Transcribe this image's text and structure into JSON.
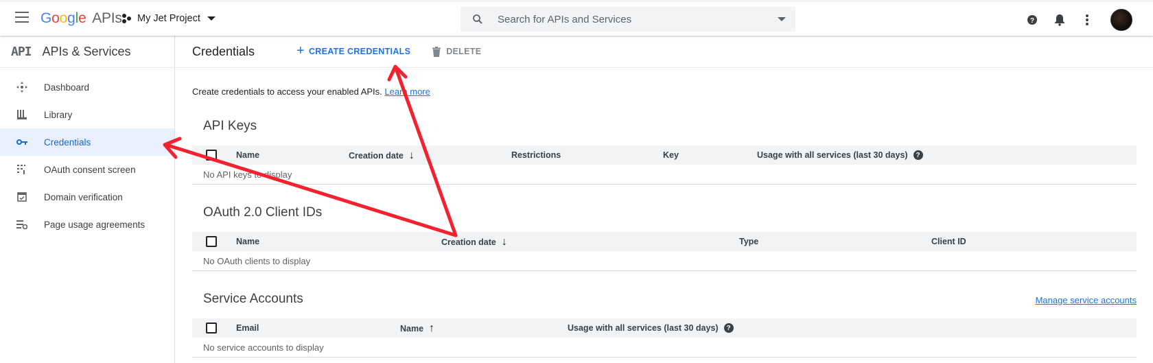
{
  "topbar": {
    "logo_letters": [
      "G",
      "o",
      "o",
      "g",
      "l",
      "e"
    ],
    "logo_suffix": "APIs",
    "project_name": "My Jet Project",
    "search_placeholder": "Search for APIs and Services",
    "icons": [
      "help-icon",
      "notifications-icon",
      "more-vert-icon",
      "account-avatar"
    ]
  },
  "sidebar": {
    "mark": "API",
    "title": "APIs & Services",
    "items": [
      {
        "label": "Dashboard",
        "icon": "dashboard-icon"
      },
      {
        "label": "Library",
        "icon": "library-icon"
      },
      {
        "label": "Credentials",
        "icon": "key-icon",
        "active": true
      },
      {
        "label": "OAuth consent screen",
        "icon": "consent-icon"
      },
      {
        "label": "Domain verification",
        "icon": "domain-verification-icon"
      },
      {
        "label": "Page usage agreements",
        "icon": "page-usage-icon"
      }
    ]
  },
  "main": {
    "title": "Credentials",
    "create_label": "CREATE CREDENTIALS",
    "delete_label": "DELETE",
    "intro_text": "Create credentials to access your enabled APIs. ",
    "intro_link": "Learn more",
    "api_keys": {
      "title": "API Keys",
      "columns": [
        "Name",
        "Creation date",
        "Restrictions",
        "Key",
        "Usage with all services (last 30 days)"
      ],
      "empty": "No API keys to display"
    },
    "oauth": {
      "title": "OAuth 2.0 Client IDs",
      "columns": [
        "Name",
        "Creation date",
        "Type",
        "Client ID"
      ],
      "empty": "No OAuth clients to display"
    },
    "service_accounts": {
      "title": "Service Accounts",
      "manage_link": "Manage service accounts",
      "columns": [
        "Email",
        "Name",
        "Usage with all services (last 30 days)"
      ],
      "empty": "No service accounts to display"
    }
  },
  "colors": {
    "accent": "#1a73e8",
    "active_bg": "#e8f0fe",
    "arrow": "#f2222e"
  }
}
